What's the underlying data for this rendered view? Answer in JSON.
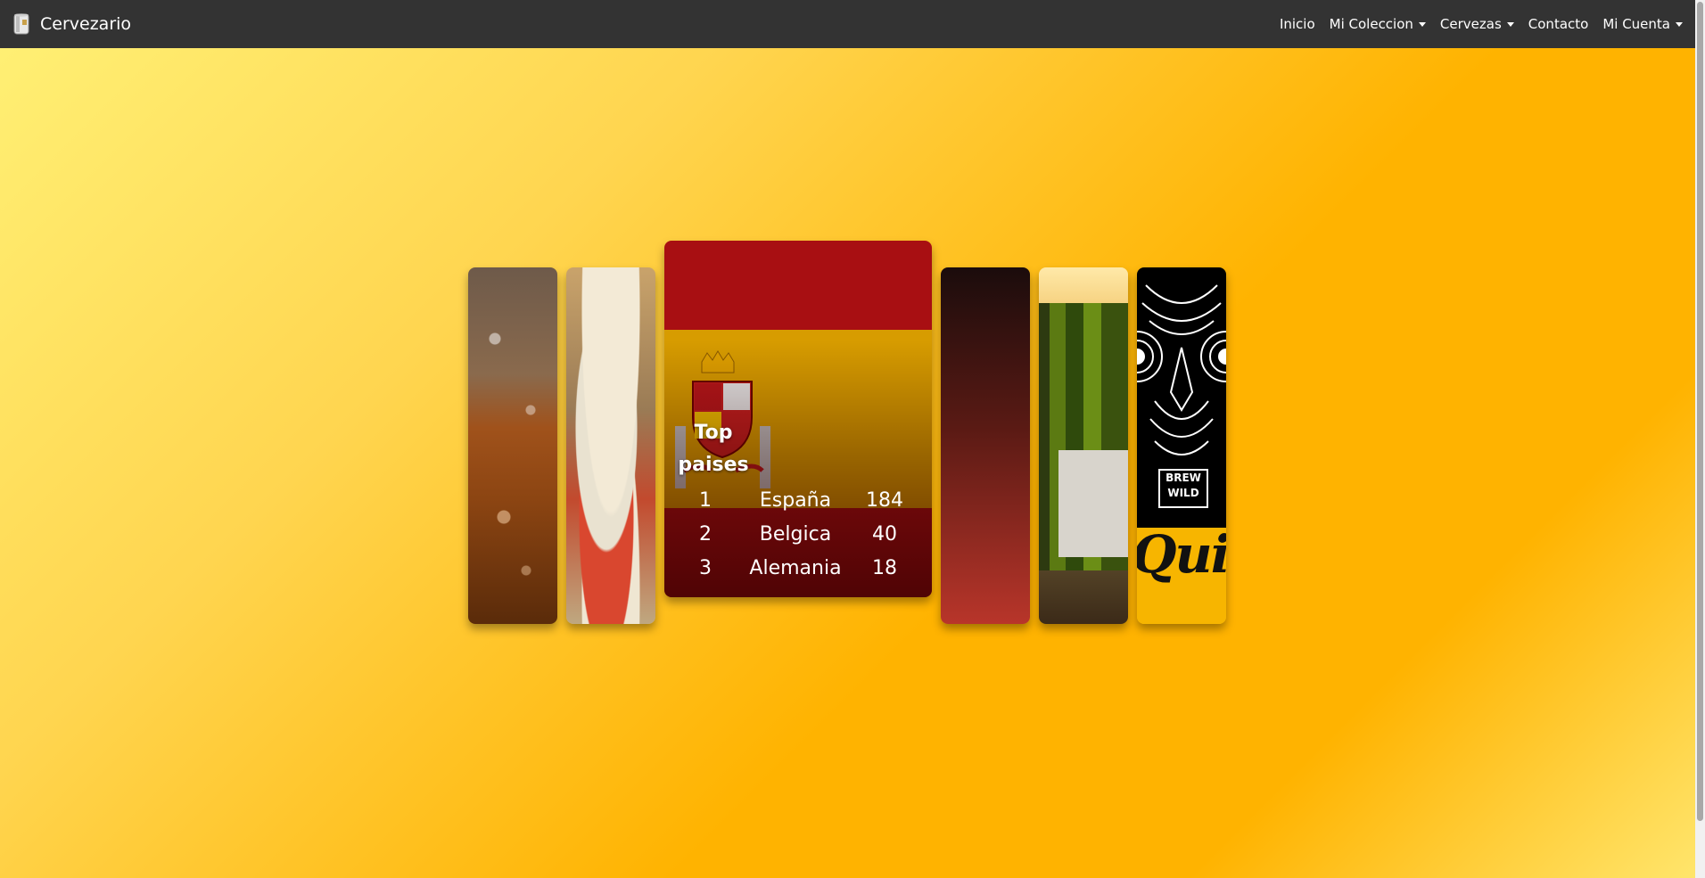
{
  "navbar": {
    "brand": "Cervezario",
    "items": [
      {
        "label": "Inicio",
        "dropdown": false
      },
      {
        "label": "Mi Coleccion",
        "dropdown": true
      },
      {
        "label": "Cervezas",
        "dropdown": true
      },
      {
        "label": "Contacto",
        "dropdown": false
      },
      {
        "label": "Mi Cuenta",
        "dropdown": true
      }
    ]
  },
  "card": {
    "title": "Top paises",
    "rows": [
      {
        "rank": "1",
        "country": "España",
        "count": "184"
      },
      {
        "rank": "2",
        "country": "Belgica",
        "count": "40"
      },
      {
        "rank": "3",
        "country": "Alemania",
        "count": "18"
      }
    ]
  },
  "panels": {
    "brewwild_text": "BREW WILD",
    "quirk_text": "Quirk"
  },
  "colors": {
    "navbar_bg": "#333333",
    "background_gradient": [
      "#fff176",
      "#ffb300"
    ],
    "flag_red": "#a80f12",
    "flag_yellow": "#d79c00"
  },
  "icons": {
    "brand": "beer-can-icon",
    "dropdown": "caret-down-icon"
  }
}
